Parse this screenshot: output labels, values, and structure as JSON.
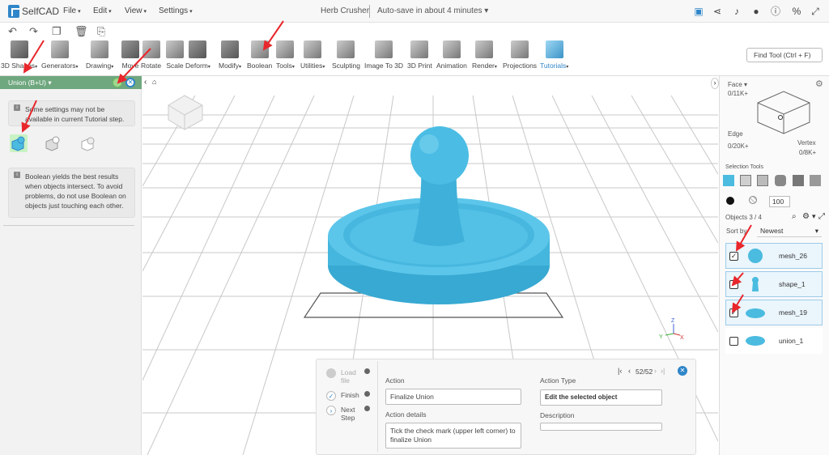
{
  "app": {
    "name": "SelfCAD",
    "title": "Herb Crusher",
    "autosave": "Auto-save in about 4 minutes"
  },
  "menus": [
    "File",
    "Edit",
    "View",
    "Settings"
  ],
  "toolbar": [
    {
      "label": "3D Shapes",
      "has_menu": true
    },
    {
      "label": "Generators",
      "has_menu": true
    },
    {
      "label": "Drawing",
      "has_menu": true
    },
    {
      "label": "Move",
      "has_menu": false
    },
    {
      "label": "Rotate",
      "has_menu": false
    },
    {
      "label": "Scale",
      "has_menu": false
    },
    {
      "label": "Deform",
      "has_menu": true
    },
    {
      "label": "Modify",
      "has_menu": true
    },
    {
      "label": "Boolean",
      "has_menu": false
    },
    {
      "label": "Tools",
      "has_menu": true
    },
    {
      "label": "Utilities",
      "has_menu": true
    },
    {
      "label": "Sculpting",
      "has_menu": false
    },
    {
      "label": "Image To 3D",
      "has_menu": false
    },
    {
      "label": "3D Print",
      "has_menu": false
    },
    {
      "label": "Animation",
      "has_menu": false
    },
    {
      "label": "Render",
      "has_menu": true
    },
    {
      "label": "Projections",
      "has_menu": false
    },
    {
      "label": "Tutorials",
      "has_menu": true
    }
  ],
  "find_tool": "Find Tool (Ctrl + F)",
  "left_panel": {
    "header": "Union (B+U)",
    "note1": "Some settings may not be available in current Tutorial step.",
    "note2": "Boolean yields the best results when objects intersect. To avoid problems, do not use Boolean on objects just touching each other."
  },
  "right_panel": {
    "face_label": "Face",
    "face_count": "0/11K+",
    "edge_label": "Edge",
    "edge_count": "0/20K+",
    "vertex_label": "Vertex",
    "vertex_count": "0/8K+",
    "selection_tools": "Selection Tools",
    "opacity_value": "100",
    "objects_label": "Objects 3 / 4",
    "sort_label": "Sort by",
    "sort_value": "Newest",
    "objects": [
      {
        "name": "mesh_26",
        "checked": true,
        "selected": true
      },
      {
        "name": "shape_1",
        "checked": true,
        "selected": true
      },
      {
        "name": "mesh_19",
        "checked": true,
        "selected": true
      },
      {
        "name": "union_1",
        "checked": false,
        "selected": false
      }
    ]
  },
  "tutorial": {
    "pagination": "52/52",
    "steps": [
      "Load file",
      "Finish",
      "Next Step"
    ],
    "action_label": "Action",
    "action_value": "Finalize Union",
    "action_details_label": "Action details",
    "action_details_value": "Tick the check mark (upper left corner) to finalize Union",
    "action_type_label": "Action Type",
    "action_type_value": "Edit the selected object",
    "description_label": "Description",
    "description_value": ""
  },
  "colors": {
    "model": "#4bbbe0",
    "accent": "#2f86c9",
    "panel_header": "#6fa77e",
    "arrow": "#e8262b"
  }
}
